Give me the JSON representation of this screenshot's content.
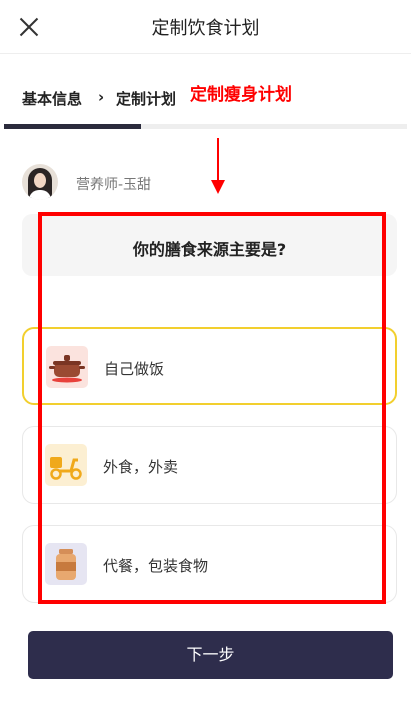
{
  "header": {
    "title": "定制饮食计划",
    "close_icon": "close-icon"
  },
  "steps": {
    "step1": "基本信息",
    "separator": "›",
    "step2": "定制计划"
  },
  "annotation": {
    "text": "定制瘦身计划",
    "color": "#ff0000"
  },
  "progress": {
    "value": 0.34
  },
  "coach": {
    "name": "营养师-玉甜"
  },
  "question": {
    "text": "你的膳食来源主要是?"
  },
  "options": [
    {
      "label": "自己做饭",
      "icon": "cooking-pot-icon",
      "selected": true
    },
    {
      "label": "外食，外卖",
      "icon": "delivery-scooter-icon",
      "selected": false
    },
    {
      "label": "代餐，包装食物",
      "icon": "food-jar-icon",
      "selected": false
    }
  ],
  "footer": {
    "next_label": "下一步"
  },
  "colors": {
    "accent_selected": "#f2cf2e",
    "button": "#2e2d4c",
    "annotation": "#ff0000"
  }
}
